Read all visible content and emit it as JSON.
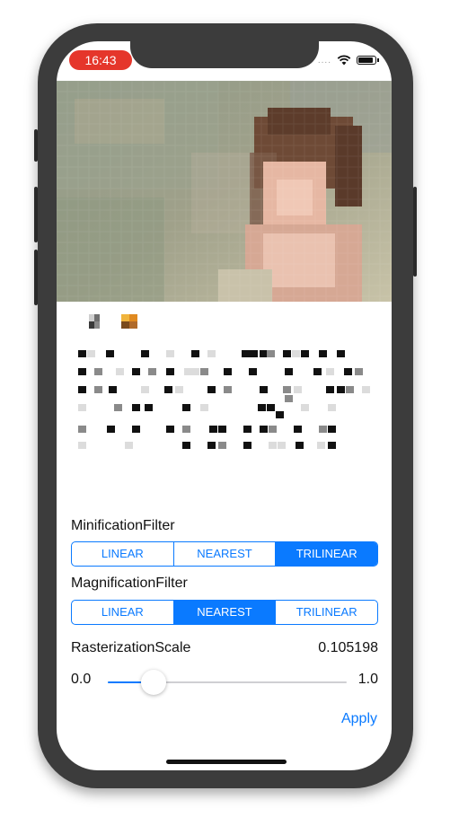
{
  "status_bar": {
    "time": "16:43",
    "signal_dots": "....",
    "wifi_icon": "wifi-icon",
    "battery_icon": "battery-icon"
  },
  "minification": {
    "title": "MinificationFilter",
    "options": [
      "LINEAR",
      "NEAREST",
      "TRILINEAR"
    ],
    "selected": "TRILINEAR"
  },
  "magnification": {
    "title": "MagnificationFilter",
    "options": [
      "LINEAR",
      "NEAREST",
      "TRILINEAR"
    ],
    "selected": "NEAREST"
  },
  "rasterization": {
    "title": "RasterizationScale",
    "value_text": "0.105198",
    "min_label": "0.0",
    "max_label": "1.0",
    "value": 0.105198
  },
  "apply_label": "Apply",
  "colors": {
    "accent": "#0a7aff",
    "time_pill": "#e5362b",
    "frame": "#3c3c3c"
  }
}
